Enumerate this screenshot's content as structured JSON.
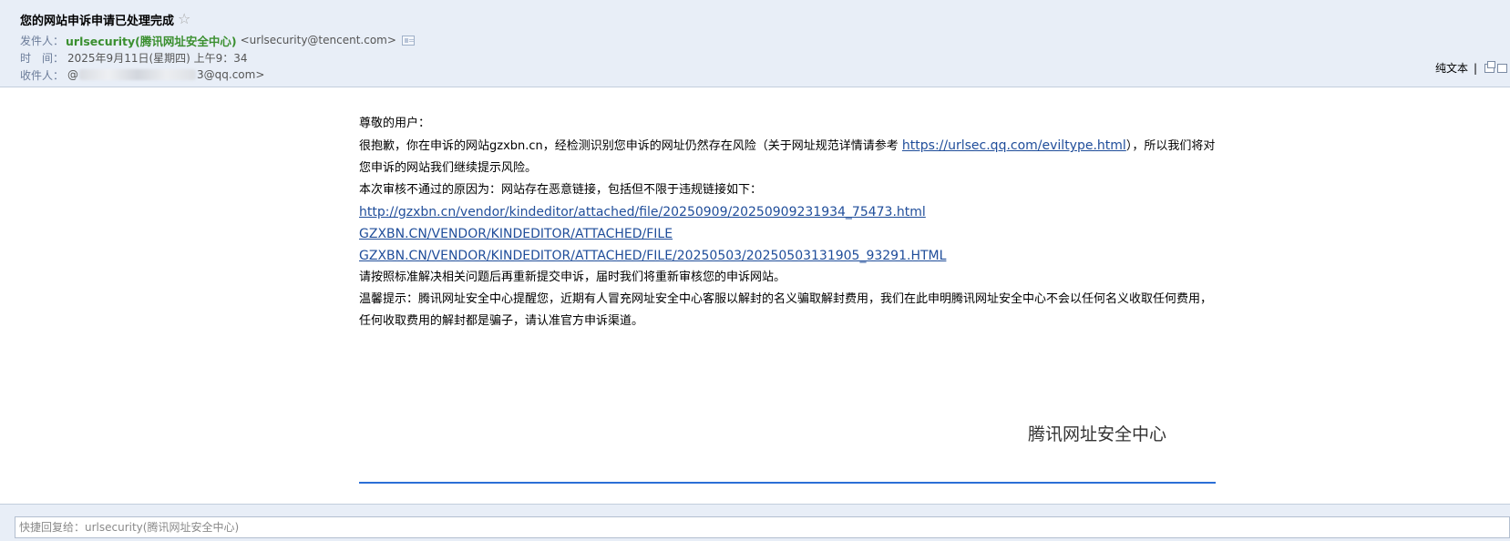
{
  "header": {
    "subject": "您的网站申诉申请已处理完成",
    "star_icon": "☆",
    "from_label": "发件人：",
    "sender_name": "urlsecurity(腾讯网址安全中心)",
    "sender_email": "<urlsecurity@tencent.com>",
    "time_label": "时　间：",
    "time_value": "2025年9月11日(星期四) 上午9：34",
    "to_label": "收件人：",
    "recipient_prefix": "@",
    "recipient_suffix": "3@qq.com>",
    "plain_text_label": "纯文本",
    "separator": "|"
  },
  "body": {
    "greeting": "尊敬的用户：",
    "para1_a": "很抱歉，你在申诉的网站gzxbn.cn，经检测识别您申诉的网址仍然存在风险（关于网址规范详情请参考 ",
    "para1_link": "https://urlsec.qq.com/eviltype.html",
    "para1_b": "），所以我们将对您申诉的网站我们继续提示风险。",
    "reason": "本次审核不通过的原因为：网站存在恶意链接，包括但不限于违规链接如下：",
    "links": [
      "http://gzxbn.cn/vendor/kindeditor/attached/file/20250909/20250909231934_75473.html",
      "GZXBN.CN/VENDOR/KINDEDITOR/ATTACHED/FILE",
      "GZXBN.CN/VENDOR/KINDEDITOR/ATTACHED/FILE/20250503/20250503131905_93291.HTML"
    ],
    "resubmit": "请按照标准解决相关问题后再重新提交申诉，届时我们将重新审核您的申诉网站。",
    "warning": "温馨提示：腾讯网址安全中心提醒您，近期有人冒充网址安全中心客服以解封的名义骗取解封费用，我们在此申明腾讯网址安全中心不会以任何名义收取任何费用，任何收取费用的解封都是骗子，请认准官方申诉渠道。",
    "signature": "腾讯网址安全中心"
  },
  "footer": {
    "quick_reply_placeholder": "快捷回复给：urlsecurity(腾讯网址安全中心)"
  },
  "colors": {
    "header_bg": "#e8eef7",
    "sender_green": "#3a8f2f",
    "link_blue": "#1f4d9a",
    "divider_blue": "#2b6fd6"
  }
}
